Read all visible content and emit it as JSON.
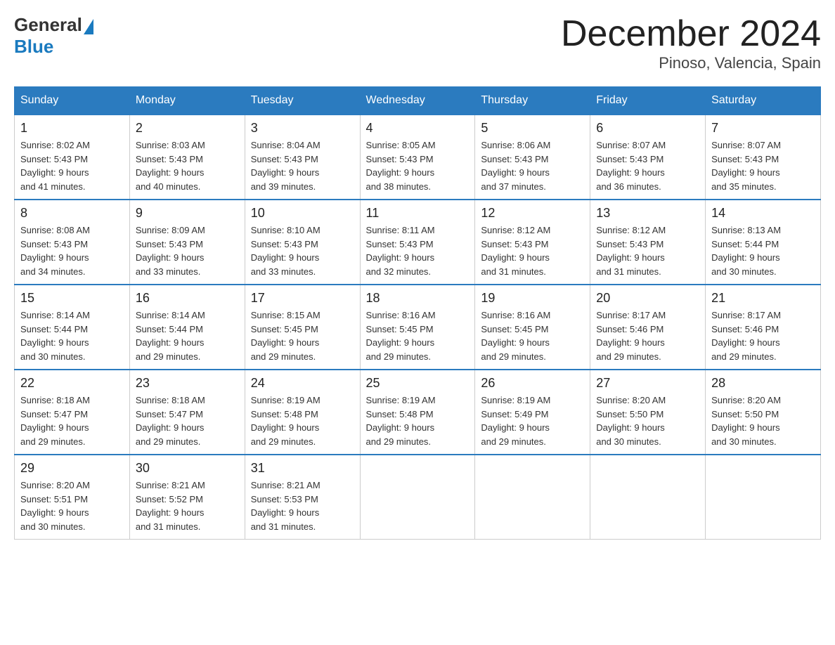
{
  "logo": {
    "general": "General",
    "blue": "Blue"
  },
  "header": {
    "month": "December 2024",
    "location": "Pinoso, Valencia, Spain"
  },
  "days_header": [
    "Sunday",
    "Monday",
    "Tuesday",
    "Wednesday",
    "Thursday",
    "Friday",
    "Saturday"
  ],
  "weeks": [
    [
      {
        "day": "1",
        "sunrise": "8:02 AM",
        "sunset": "5:43 PM",
        "daylight": "9 hours and 41 minutes."
      },
      {
        "day": "2",
        "sunrise": "8:03 AM",
        "sunset": "5:43 PM",
        "daylight": "9 hours and 40 minutes."
      },
      {
        "day": "3",
        "sunrise": "8:04 AM",
        "sunset": "5:43 PM",
        "daylight": "9 hours and 39 minutes."
      },
      {
        "day": "4",
        "sunrise": "8:05 AM",
        "sunset": "5:43 PM",
        "daylight": "9 hours and 38 minutes."
      },
      {
        "day": "5",
        "sunrise": "8:06 AM",
        "sunset": "5:43 PM",
        "daylight": "9 hours and 37 minutes."
      },
      {
        "day": "6",
        "sunrise": "8:07 AM",
        "sunset": "5:43 PM",
        "daylight": "9 hours and 36 minutes."
      },
      {
        "day": "7",
        "sunrise": "8:07 AM",
        "sunset": "5:43 PM",
        "daylight": "9 hours and 35 minutes."
      }
    ],
    [
      {
        "day": "8",
        "sunrise": "8:08 AM",
        "sunset": "5:43 PM",
        "daylight": "9 hours and 34 minutes."
      },
      {
        "day": "9",
        "sunrise": "8:09 AM",
        "sunset": "5:43 PM",
        "daylight": "9 hours and 33 minutes."
      },
      {
        "day": "10",
        "sunrise": "8:10 AM",
        "sunset": "5:43 PM",
        "daylight": "9 hours and 33 minutes."
      },
      {
        "day": "11",
        "sunrise": "8:11 AM",
        "sunset": "5:43 PM",
        "daylight": "9 hours and 32 minutes."
      },
      {
        "day": "12",
        "sunrise": "8:12 AM",
        "sunset": "5:43 PM",
        "daylight": "9 hours and 31 minutes."
      },
      {
        "day": "13",
        "sunrise": "8:12 AM",
        "sunset": "5:43 PM",
        "daylight": "9 hours and 31 minutes."
      },
      {
        "day": "14",
        "sunrise": "8:13 AM",
        "sunset": "5:44 PM",
        "daylight": "9 hours and 30 minutes."
      }
    ],
    [
      {
        "day": "15",
        "sunrise": "8:14 AM",
        "sunset": "5:44 PM",
        "daylight": "9 hours and 30 minutes."
      },
      {
        "day": "16",
        "sunrise": "8:14 AM",
        "sunset": "5:44 PM",
        "daylight": "9 hours and 29 minutes."
      },
      {
        "day": "17",
        "sunrise": "8:15 AM",
        "sunset": "5:45 PM",
        "daylight": "9 hours and 29 minutes."
      },
      {
        "day": "18",
        "sunrise": "8:16 AM",
        "sunset": "5:45 PM",
        "daylight": "9 hours and 29 minutes."
      },
      {
        "day": "19",
        "sunrise": "8:16 AM",
        "sunset": "5:45 PM",
        "daylight": "9 hours and 29 minutes."
      },
      {
        "day": "20",
        "sunrise": "8:17 AM",
        "sunset": "5:46 PM",
        "daylight": "9 hours and 29 minutes."
      },
      {
        "day": "21",
        "sunrise": "8:17 AM",
        "sunset": "5:46 PM",
        "daylight": "9 hours and 29 minutes."
      }
    ],
    [
      {
        "day": "22",
        "sunrise": "8:18 AM",
        "sunset": "5:47 PM",
        "daylight": "9 hours and 29 minutes."
      },
      {
        "day": "23",
        "sunrise": "8:18 AM",
        "sunset": "5:47 PM",
        "daylight": "9 hours and 29 minutes."
      },
      {
        "day": "24",
        "sunrise": "8:19 AM",
        "sunset": "5:48 PM",
        "daylight": "9 hours and 29 minutes."
      },
      {
        "day": "25",
        "sunrise": "8:19 AM",
        "sunset": "5:48 PM",
        "daylight": "9 hours and 29 minutes."
      },
      {
        "day": "26",
        "sunrise": "8:19 AM",
        "sunset": "5:49 PM",
        "daylight": "9 hours and 29 minutes."
      },
      {
        "day": "27",
        "sunrise": "8:20 AM",
        "sunset": "5:50 PM",
        "daylight": "9 hours and 30 minutes."
      },
      {
        "day": "28",
        "sunrise": "8:20 AM",
        "sunset": "5:50 PM",
        "daylight": "9 hours and 30 minutes."
      }
    ],
    [
      {
        "day": "29",
        "sunrise": "8:20 AM",
        "sunset": "5:51 PM",
        "daylight": "9 hours and 30 minutes."
      },
      {
        "day": "30",
        "sunrise": "8:21 AM",
        "sunset": "5:52 PM",
        "daylight": "9 hours and 31 minutes."
      },
      {
        "day": "31",
        "sunrise": "8:21 AM",
        "sunset": "5:53 PM",
        "daylight": "9 hours and 31 minutes."
      },
      null,
      null,
      null,
      null
    ]
  ]
}
